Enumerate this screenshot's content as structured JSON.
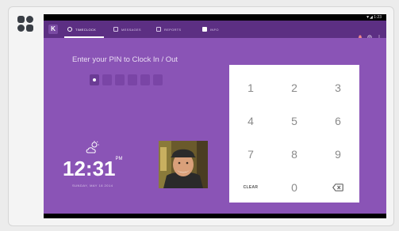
{
  "app": {
    "logo": "brand-logo",
    "accent": "#8a54b6",
    "header_color": "#5c2f83",
    "status_text": "▼◢ 1:23"
  },
  "header": {
    "app_icon": "K",
    "tabs": [
      {
        "label": "TIMECLOCK",
        "icon": "clock-icon",
        "active": true
      },
      {
        "label": "MESSAGES",
        "icon": "message-icon",
        "active": false
      },
      {
        "label": "REPORTS",
        "icon": "report-icon",
        "active": false
      },
      {
        "label": "INFO",
        "icon": "info-icon",
        "active": false
      }
    ],
    "right_icons": [
      "bell-icon",
      "settings-icon",
      "more-icon"
    ]
  },
  "clock_in": {
    "prompt": "Enter your PIN to Clock In / Out",
    "pin_length": 6,
    "digits_entered": 1
  },
  "weather": {
    "icon": "cloud-sun-icon"
  },
  "clock": {
    "time": "12:31",
    "ampm": "PM",
    "date": "SUNDAY, MAY 18 2014"
  },
  "keypad": {
    "keys": [
      "1",
      "2",
      "3",
      "4",
      "5",
      "6",
      "7",
      "8",
      "9",
      "CLEAR",
      "0",
      "backspace"
    ]
  }
}
